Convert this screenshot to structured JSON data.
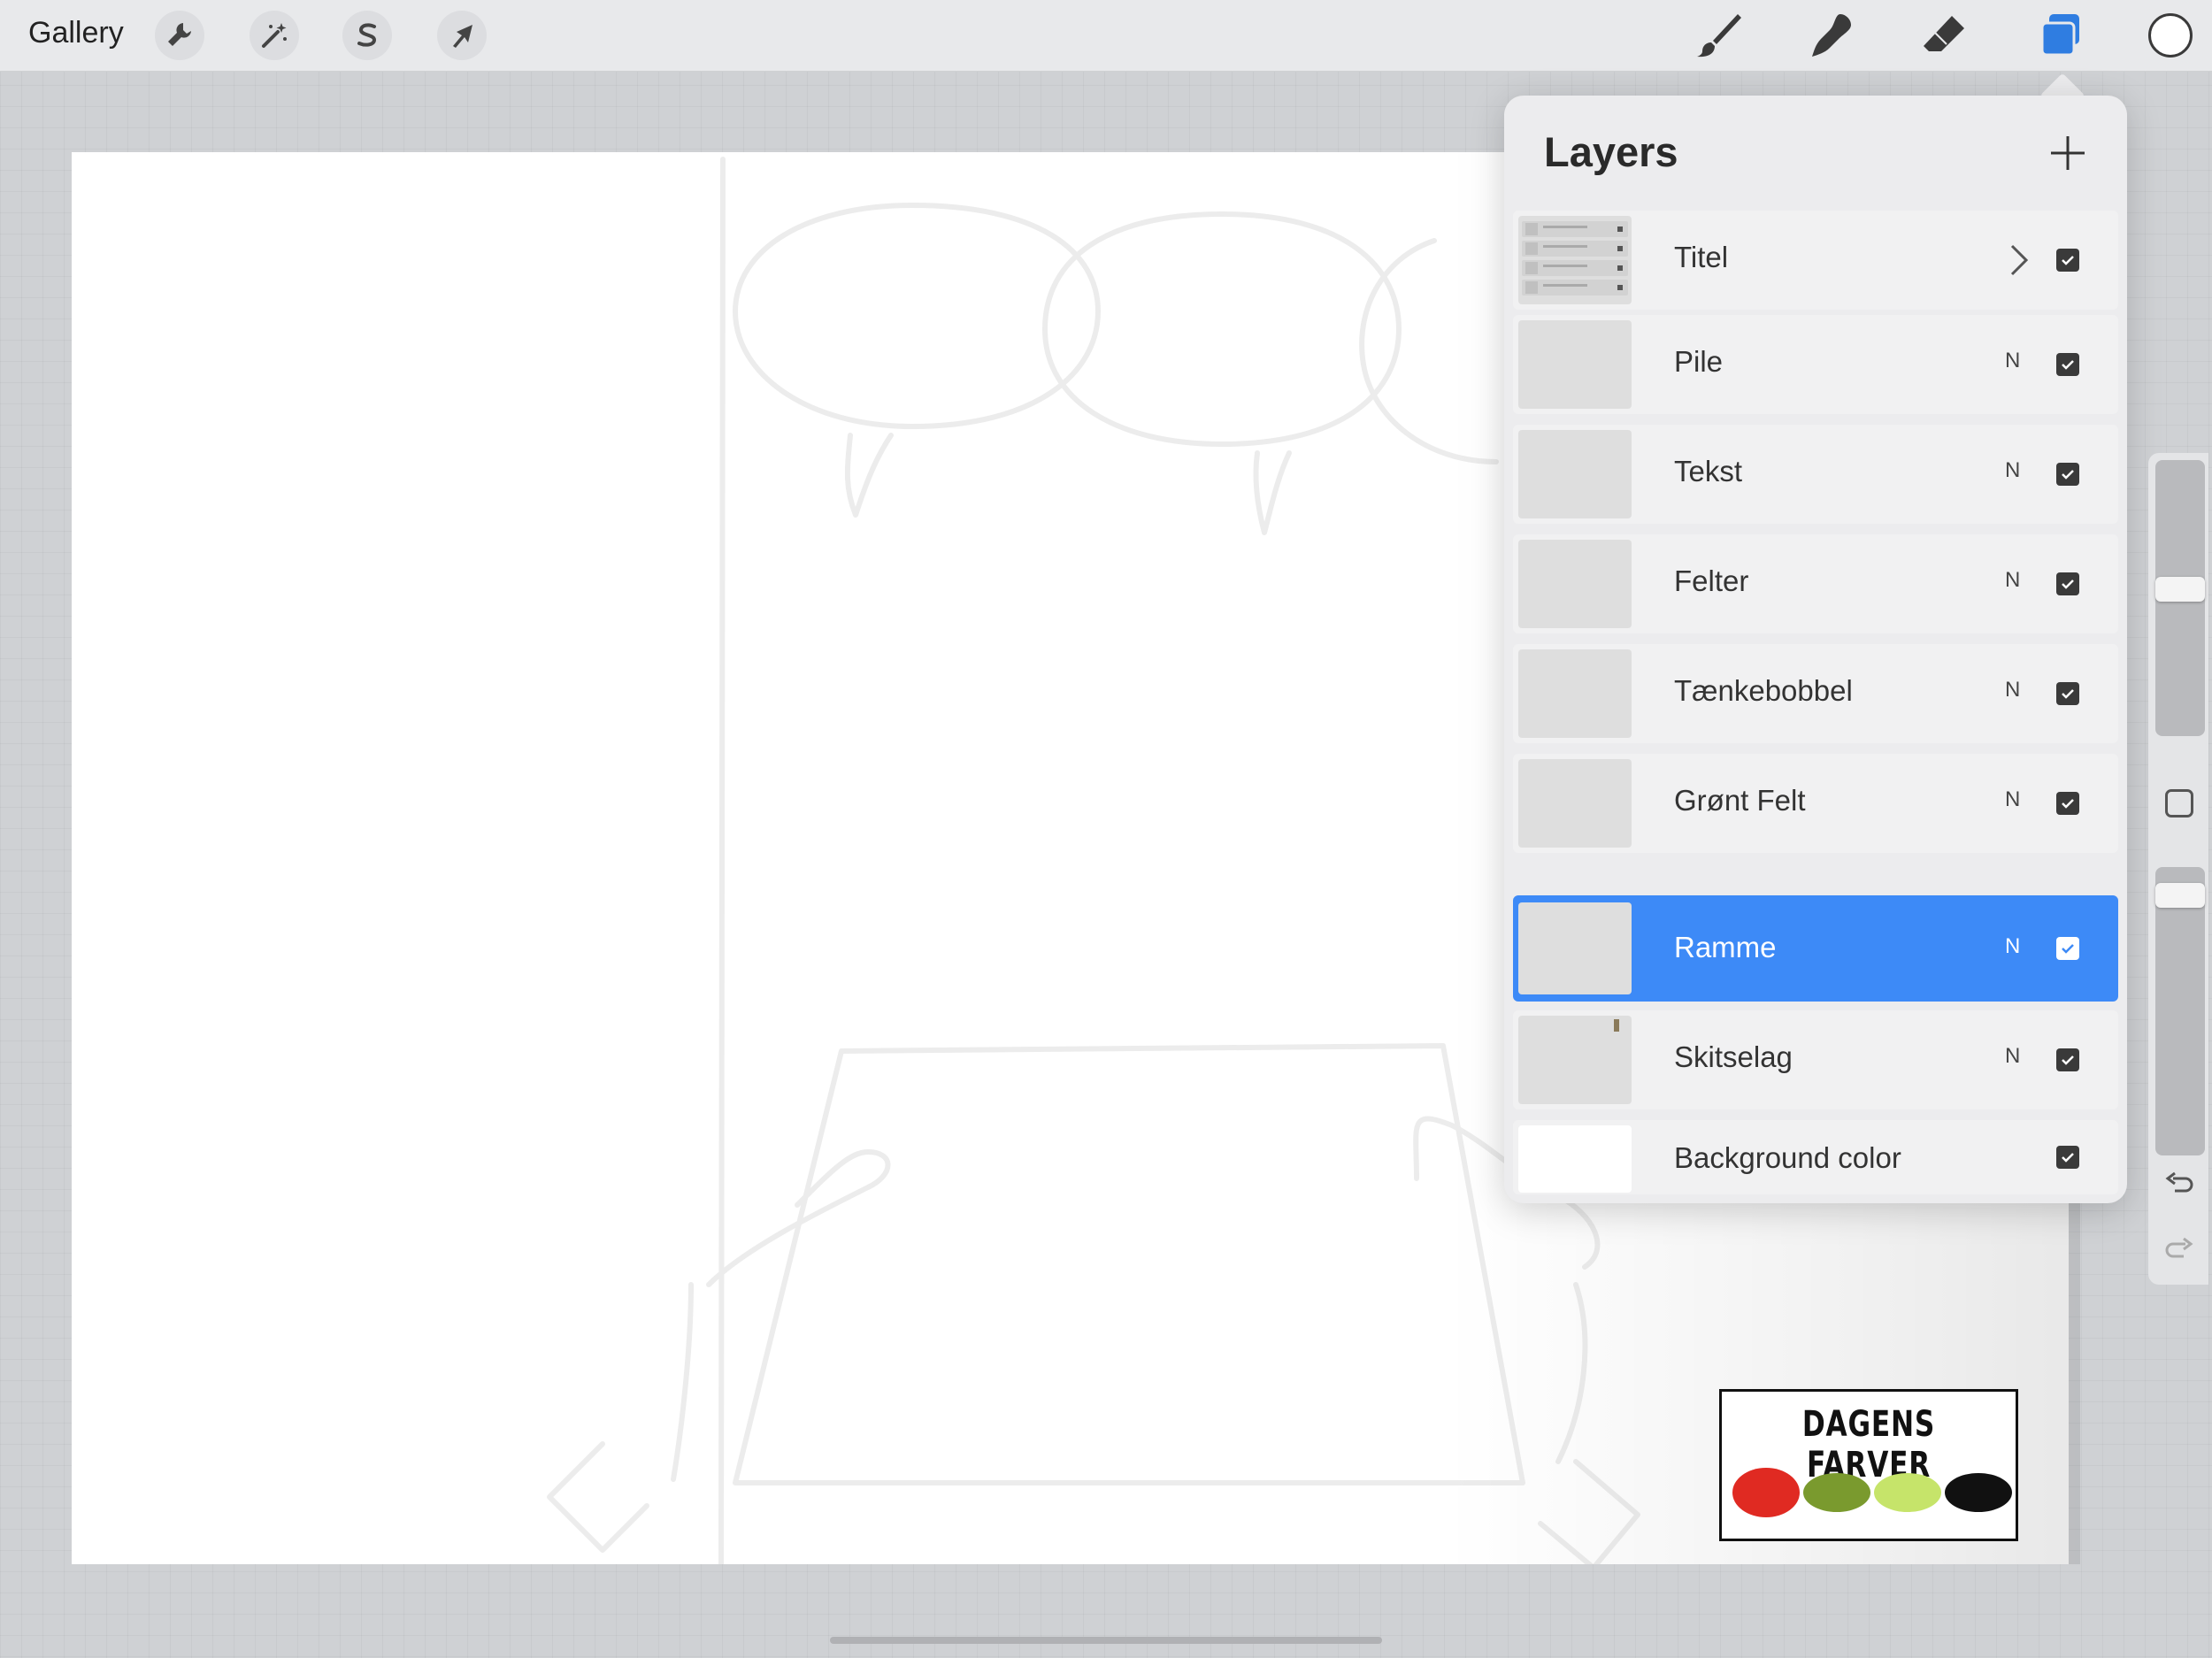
{
  "toolbar": {
    "gallery_label": "Gallery",
    "left_tools": [
      "wrench-icon",
      "magic-wand-icon",
      "selection-s-icon",
      "transform-arrow-icon"
    ],
    "right_tools": [
      "brush-icon",
      "smudge-icon",
      "eraser-icon",
      "layers-icon"
    ],
    "layers_active_color": "#2f7de1",
    "current_color": "#ffffff"
  },
  "layers_panel": {
    "title": "Layers",
    "add_icon": "plus-icon",
    "layers": [
      {
        "name": "Titel",
        "blend": "",
        "visible": true,
        "group": true,
        "selected": false
      },
      {
        "name": "Pile",
        "blend": "N",
        "visible": true,
        "group": false,
        "selected": false
      },
      {
        "name": "Tekst",
        "blend": "N",
        "visible": true,
        "group": false,
        "selected": false
      },
      {
        "name": "Felter",
        "blend": "N",
        "visible": true,
        "group": false,
        "selected": false
      },
      {
        "name": "Tænkebobbel",
        "blend": "N",
        "visible": true,
        "group": false,
        "selected": false
      },
      {
        "name": "Grønt Felt",
        "blend": "N",
        "visible": true,
        "group": false,
        "selected": false
      },
      {
        "name": "Ramme",
        "blend": "N",
        "visible": true,
        "group": false,
        "selected": true
      },
      {
        "name": "Skitselag",
        "blend": "N",
        "visible": true,
        "group": false,
        "selected": false
      },
      {
        "name": "Background color",
        "blend": "",
        "visible": true,
        "group": false,
        "selected": false
      }
    ],
    "selection_color": "#3d8af7"
  },
  "canvas": {
    "logo_text": "DAGENS FARVER",
    "swatches": [
      "#e02a22",
      "#7a9a2e",
      "#c6e46a",
      "#111111"
    ]
  },
  "sidebar": {
    "undo_icon": "undo-icon",
    "redo_icon": "redo-icon"
  }
}
